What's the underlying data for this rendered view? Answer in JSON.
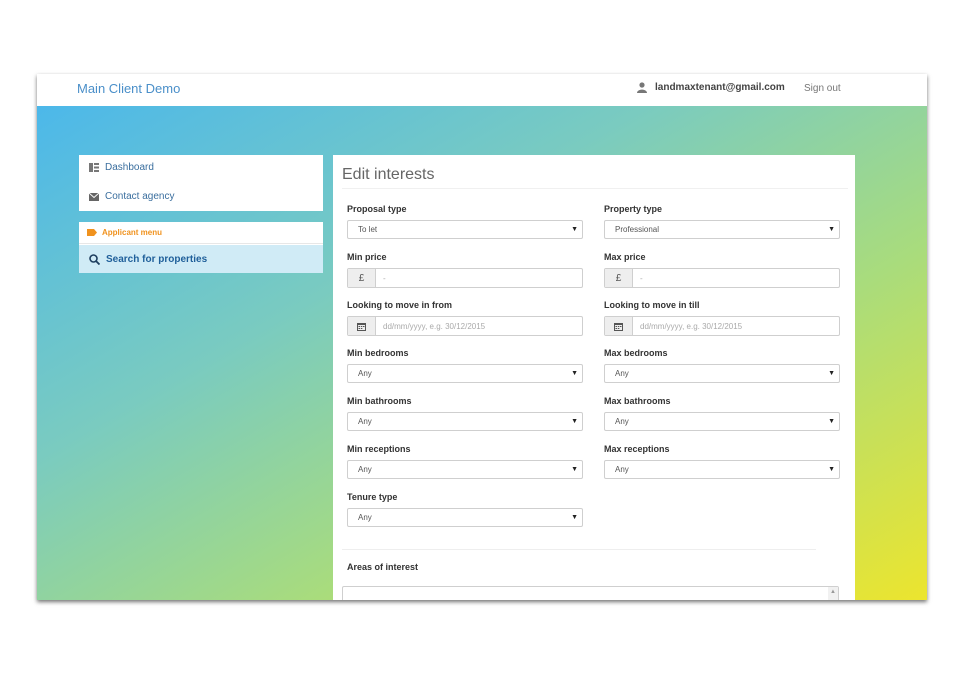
{
  "app": {
    "title": "Main Client Demo"
  },
  "header": {
    "user_email": "landmaxtenant@gmail.com",
    "signout_label": "Sign out"
  },
  "sidebar": {
    "items": [
      {
        "label": "Dashboard",
        "icon": "dashboard-icon"
      },
      {
        "label": "Contact agency",
        "icon": "envelope-icon"
      }
    ],
    "applicant_menu": {
      "label": "Applicant menu",
      "icon": "tag-icon"
    },
    "search": {
      "label": "Search for properties",
      "icon": "search-icon",
      "active": true
    }
  },
  "form": {
    "title": "Edit interests",
    "currency_symbol": "£",
    "date_placeholder": "dd/mm/yyyy, e.g. 30/12/2015",
    "price_placeholder": "-",
    "proposal_type": {
      "label": "Proposal type",
      "value": "To let"
    },
    "property_type": {
      "label": "Property type",
      "value": "Professional"
    },
    "min_price": {
      "label": "Min price",
      "value": ""
    },
    "max_price": {
      "label": "Max price",
      "value": ""
    },
    "move_from": {
      "label": "Looking to move in from",
      "value": ""
    },
    "move_till": {
      "label": "Looking to move in till",
      "value": ""
    },
    "min_bedrooms": {
      "label": "Min bedrooms",
      "value": "Any"
    },
    "max_bedrooms": {
      "label": "Max bedrooms",
      "value": "Any"
    },
    "min_bathrooms": {
      "label": "Min bathrooms",
      "value": "Any"
    },
    "max_bathrooms": {
      "label": "Max bathrooms",
      "value": "Any"
    },
    "min_receptions": {
      "label": "Min receptions",
      "value": "Any"
    },
    "max_receptions": {
      "label": "Max receptions",
      "value": "Any"
    },
    "tenure_type": {
      "label": "Tenure type",
      "value": "Any"
    },
    "areas_of_interest": {
      "label": "Areas of interest",
      "value": ""
    }
  },
  "colors": {
    "brand": "#4a8fc9",
    "accent_orange": "#f0921e",
    "active_nav_bg": "#d0ebf6",
    "gradient_start": "#4cb8ea",
    "gradient_end": "#ece52e"
  }
}
